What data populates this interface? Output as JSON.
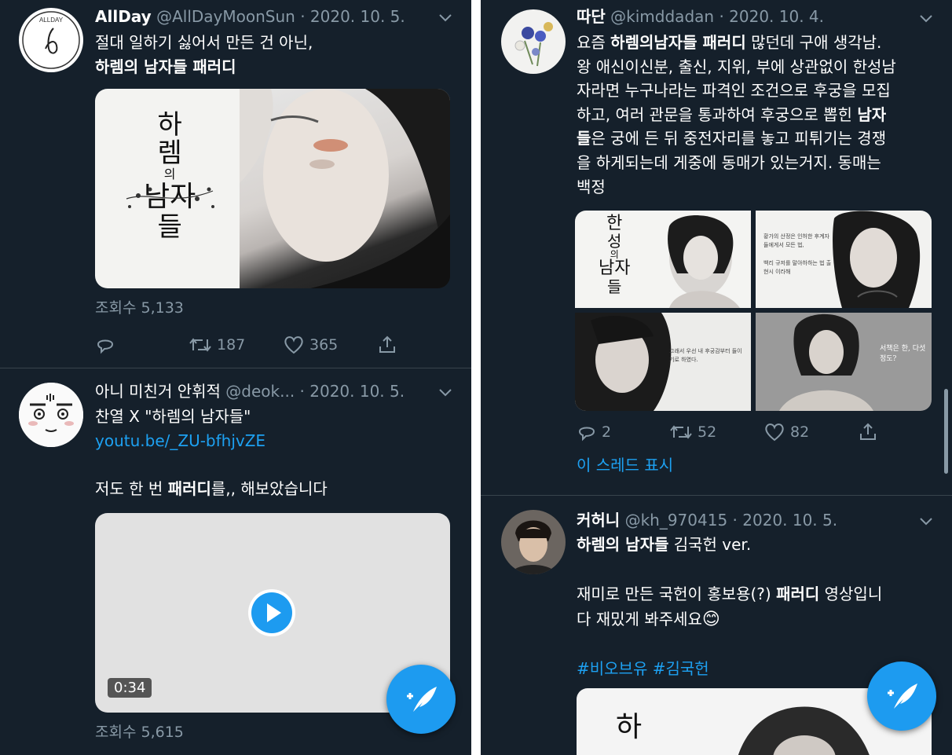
{
  "left": {
    "tweet1": {
      "name": "AllDay",
      "handle": "@AllDayMoonSun",
      "date": "· 2020. 10. 5.",
      "line1": "절대 일하기 싫어서 만든 건 아닌,",
      "line2": "하렘의 남자들 패러디",
      "avatar_text": "ALLDAY",
      "poster_title": [
        "하",
        "렘",
        "의",
        "남자",
        "들"
      ],
      "views": "조회수 5,133",
      "retweets": "187",
      "likes": "365"
    },
    "tweet2": {
      "name": "아니 미친거 안휘적",
      "handle": "@deok...",
      "date": "· 2020. 10. 5.",
      "line1": "찬열 X \"하렘의 남자들\"",
      "link": "youtu.be/_ZU-bfhjvZE",
      "line3_pre": "저도 한 번 ",
      "line3_bold": "패러디",
      "line3_post": "를,, 해보았습니다",
      "duration": "0:34",
      "views": "조회수 5,615"
    }
  },
  "right": {
    "tweet1": {
      "name": "따단",
      "handle": "@kimddadan",
      "date": "· 2020. 10. 4.",
      "l1_pre": "요즘 ",
      "l1_bold": "하렘의남자들 패러디",
      "l1_post": " 많던데 구애 생각남.",
      "l2": "왕 애신이신분, 출신, 지위, 부에 상관없이 한성남",
      "l3": "자라면 누구나라는 파격인 조건으로 후궁을 모집",
      "l4_pre": "하고, 여러 관문을 통과하여 후궁으로 뽑힌 ",
      "l4_bold": "남자",
      "l5_bold": "들",
      "l5_post": "은 궁에 든 뒤 중전자리를 놓고 피튀기는 경쟁",
      "l6": "을 하게되는데 게중에 동매가 있는거지. 동매는",
      "l7": "백정",
      "grid_title": [
        "한",
        "성",
        "의",
        "남자",
        "들"
      ],
      "grid_text1": "황가의 산정은 인허한 후계자들에게서 모든 법,",
      "grid_text2": "백리 규저를 말아하하는 법 출현시 이라해",
      "grid_text3": "그래서 우선 내 후궁감부터 들이기로 하였다.",
      "grid_text4": "서책은 한, 다섯정도?",
      "replies": "2",
      "retweets": "52",
      "likes": "82",
      "thread": "이 스레드 표시"
    },
    "tweet2": {
      "name": "커허니",
      "handle": "@kh_970415",
      "date": "· 2020. 10. 5.",
      "l1_bold": "하렘의 남자들",
      "l1_post": " 김국헌 ver.",
      "l2_pre": "재미로 만든 국헌이 홍보용(?) ",
      "l2_bold": "패러디",
      "l2_post": " 영상입니",
      "l3": "다 재밌게 봐주세요",
      "emoji": "😊",
      "hashtags": "#비오브유 #김국헌",
      "poster_title": "하"
    }
  },
  "colors": {
    "background": "#15202b",
    "text": "#ffffff",
    "muted": "#8899a6",
    "link": "#1da1f2",
    "fab": "#1d9bf0"
  },
  "icons": [
    "chevron-down-icon",
    "reply-icon",
    "retweet-icon",
    "like-icon",
    "share-icon",
    "compose-tweet-icon",
    "play-icon"
  ]
}
